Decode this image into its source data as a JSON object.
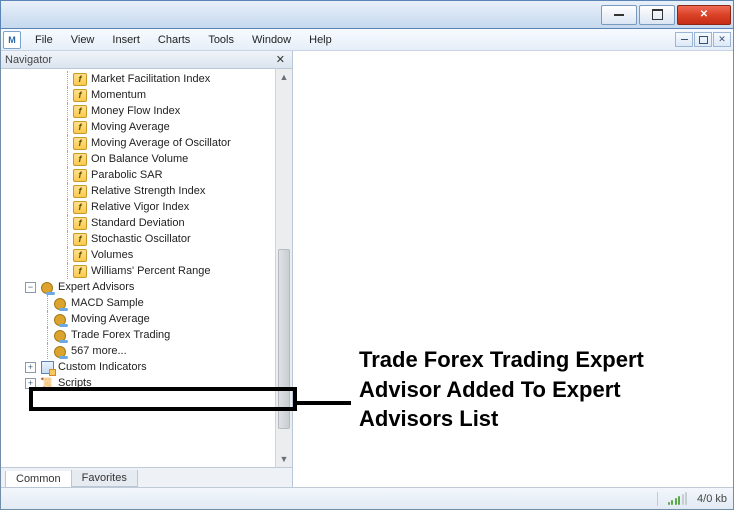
{
  "menubar": [
    "File",
    "View",
    "Insert",
    "Charts",
    "Tools",
    "Window",
    "Help"
  ],
  "navigator": {
    "title": "Navigator",
    "tabs": {
      "common": "Common",
      "favorites": "Favorites",
      "active": 0
    },
    "indicators": [
      "Market Facilitation Index",
      "Momentum",
      "Money Flow Index",
      "Moving Average",
      "Moving Average of Oscillator",
      "On Balance Volume",
      "Parabolic SAR",
      "Relative Strength Index",
      "Relative Vigor Index",
      "Standard Deviation",
      "Stochastic Oscillator",
      "Volumes",
      "Williams' Percent Range"
    ],
    "expert_advisors": {
      "label": "Expert Advisors",
      "items": [
        "MACD Sample",
        "Moving Average",
        "Trade Forex Trading",
        "567 more..."
      ]
    },
    "custom_indicators": {
      "label": "Custom Indicators"
    },
    "scripts": {
      "label": "Scripts"
    }
  },
  "status": {
    "bandwidth": "4/0 kb"
  },
  "callout": "Trade Forex Trading Expert Advisor Added To Expert Advisors List"
}
